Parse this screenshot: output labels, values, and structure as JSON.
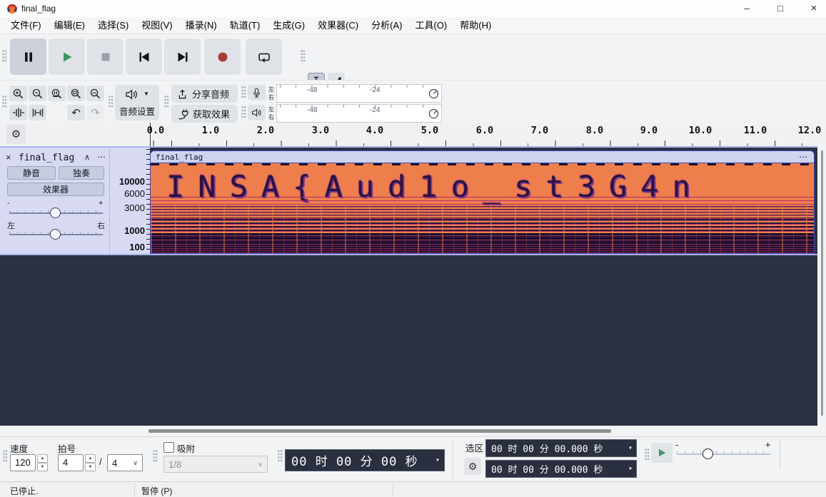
{
  "titlebar": {
    "title": "final_flag",
    "minimize": "–",
    "maximize": "□",
    "close": "×"
  },
  "menu": {
    "items": [
      "文件(F)",
      "编辑(E)",
      "选择(S)",
      "视图(V)",
      "播录(N)",
      "轨道(T)",
      "生成(G)",
      "效果器(C)",
      "分析(A)",
      "工具(O)",
      "帮助(H)"
    ]
  },
  "toolbar": {
    "audio_setup_label": "音频设置",
    "share_audio_label": "分享音频",
    "get_effects_label": "获取效果"
  },
  "meters": {
    "left": "左",
    "right": "右",
    "tick1": "-48",
    "tick2": "-24"
  },
  "timeline": {
    "labels": [
      "0.0",
      "1.0",
      "2.0",
      "3.0",
      "4.0",
      "5.0",
      "6.0",
      "7.0",
      "8.0",
      "9.0",
      "10.0",
      "11.0",
      "12.0"
    ]
  },
  "track": {
    "name": "final_flag",
    "close": "×",
    "collapse": "∧",
    "menu": "⋯",
    "mute": "静音",
    "solo": "独奏",
    "effects": "效果器",
    "gain_minus": "-",
    "gain_plus": "+",
    "pan_left": "左",
    "pan_right": "右",
    "freq": [
      "10000",
      "6000",
      "3000",
      "1000",
      "100"
    ],
    "clip_name": "final_flag",
    "clip_menu": "⋯",
    "spectrogram_text": "INSA{Aud1o_st3G4n"
  },
  "bottom": {
    "tempo_label": "速度",
    "tempo_value": "120",
    "timesig_label": "拍号",
    "timesig_upper": "4",
    "slash": "/",
    "timesig_lower": "4",
    "snap_label": "吸附",
    "snap_value": "1/8",
    "time_display": "00 时 00 分 00 秒",
    "selection_label": "选区",
    "sel_start": "00 时 00 分 00.000 秒",
    "sel_end": "00 时 00 分 00.000 秒",
    "speed_minus": "-",
    "speed_plus": "+",
    "chev": "▾"
  },
  "status": {
    "left": "已停止.",
    "right": "暂停 (P)"
  },
  "colors": {
    "spectrogram_orange": "#ee7f4c",
    "selection_blue": "#3d49b4",
    "play_green": "#3e9667",
    "record_red": "#a93b3c",
    "track_bg": "#2d3242"
  }
}
